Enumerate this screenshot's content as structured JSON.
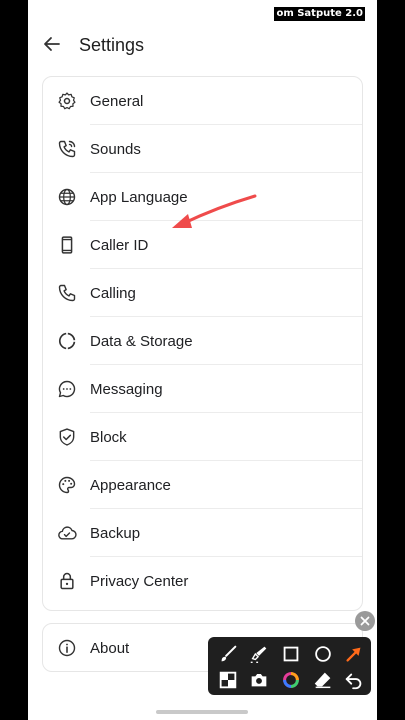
{
  "watermark": "om Satpute 2.0",
  "header": {
    "title": "Settings"
  },
  "menu": [
    {
      "label": "General",
      "icon": "gear-icon"
    },
    {
      "label": "Sounds",
      "icon": "phone-ring-icon"
    },
    {
      "label": "App Language",
      "icon": "globe-icon"
    },
    {
      "label": "Caller ID",
      "icon": "mobile-phone-icon"
    },
    {
      "label": "Calling",
      "icon": "phone-icon"
    },
    {
      "label": "Data & Storage",
      "icon": "data-circle-icon"
    },
    {
      "label": "Messaging",
      "icon": "chat-bubble-icon"
    },
    {
      "label": "Block",
      "icon": "shield-check-icon"
    },
    {
      "label": "Appearance",
      "icon": "palette-icon"
    },
    {
      "label": "Backup",
      "icon": "cloud-check-icon"
    },
    {
      "label": "Privacy Center",
      "icon": "lock-icon"
    }
  ],
  "about": {
    "label": "About",
    "icon": "info-icon"
  },
  "colors": {
    "arrow": "#ef4b4b",
    "toolbar_bg": "#1f1f1f",
    "accent_orange": "#ff6a1a"
  }
}
